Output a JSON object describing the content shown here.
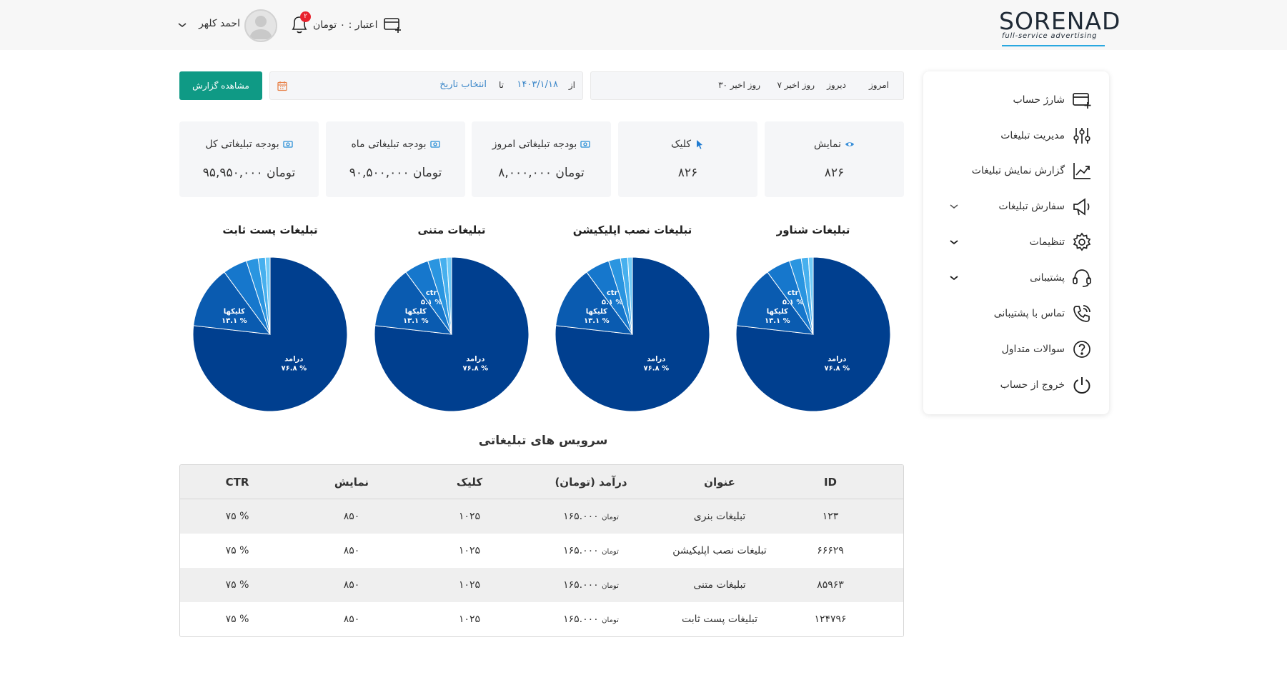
{
  "header": {
    "logo_main": "SOREN",
    "logo_ad": "AD",
    "logo_sub": "full-service advertising",
    "credit_label": "اعتبار : ۰ تومان",
    "notifications_count": "۲",
    "username": "احمد کلهر"
  },
  "sidebar": {
    "items": [
      {
        "label": "شارژ حساب",
        "icon": "add-card-icon"
      },
      {
        "label": "مدیریت تبلیغات",
        "icon": "sliders-icon"
      },
      {
        "label": "گزارش نمایش تبلیغات",
        "icon": "chart-line-icon"
      },
      {
        "label": "سفارش تبلیغات",
        "icon": "megaphone-icon"
      },
      {
        "label": "تنظیمات",
        "icon": "gear-icon"
      },
      {
        "label": "پشتیبانی",
        "icon": "headset-icon"
      },
      {
        "label": "تماس با پشتیبانی",
        "icon": "phone-icon"
      },
      {
        "label": "سوالات متداول",
        "icon": "question-icon"
      },
      {
        "label": "خروج از حساب",
        "icon": "power-icon"
      }
    ]
  },
  "filters": {
    "today": "امروز",
    "yesterday": "دیروز",
    "last7": "۷ روز اخیر",
    "last30": "۳۰ روز اخیر"
  },
  "date": {
    "from_label": "از",
    "from_value": "۱۴۰۳/۱/۱۸",
    "to_label": "تا",
    "to_value": "انتخاب تاریخ"
  },
  "report_button": "مشاهده گزارش",
  "stats": [
    {
      "label": "نمایش",
      "value": "۸۲۶",
      "icon": "eye-icon"
    },
    {
      "label": "کلیک",
      "value": "۸۲۶",
      "icon": "cursor-icon"
    },
    {
      "label": "بودجه تبلیغاتی امروز",
      "value": "۸,۰۰۰,۰۰۰ تومان",
      "icon": "cash-icon"
    },
    {
      "label": "بودجه تبلیغاتی ماه",
      "value": "۹۰,۵۰۰,۰۰۰ تومان",
      "icon": "cash-icon"
    },
    {
      "label": "بودجه تبلیغاتی کل",
      "value": "۹۵,۹۵۰,۰۰۰ تومان",
      "icon": "cash-icon"
    }
  ],
  "charts": {
    "titles": [
      "تبلیغات شناور",
      "تبلیغات نصب اپلیکیشن",
      "تبلیغات متنی",
      "تبلیغات پست ثابت"
    ],
    "slice_labels": {
      "revenue": "درامد",
      "revenue_pct": "۷۶.۸ %",
      "clicks": "کلیکها",
      "clicks_pct": "۱۳.۱ %",
      "ctr": "ctr",
      "ctr_pct": "۵.۱ %"
    },
    "colors": [
      "#003f8f",
      "#0a5bb0",
      "#1677cc",
      "#2a95e0",
      "#47b0ee",
      "#6fcaf7"
    ]
  },
  "chart_data": [
    {
      "type": "pie",
      "title": "تبلیغات شناور",
      "labels": [
        "درامد",
        "کلیکها",
        "ctr",
        "",
        "",
        ""
      ],
      "values": [
        76.8,
        13.1,
        5.1,
        2.5,
        1.5,
        1.0
      ]
    },
    {
      "type": "pie",
      "title": "تبلیغات نصب اپلیکیشن",
      "labels": [
        "درامد",
        "کلیکها",
        "ctr",
        "",
        "",
        ""
      ],
      "values": [
        76.8,
        13.1,
        5.1,
        2.5,
        1.5,
        1.0
      ]
    },
    {
      "type": "pie",
      "title": "تبلیغات متنی",
      "labels": [
        "درامد",
        "کلیکها",
        "ctr",
        "",
        "",
        ""
      ],
      "values": [
        76.8,
        13.1,
        5.1,
        2.5,
        1.5,
        1.0
      ]
    },
    {
      "type": "pie",
      "title": "تبلیغات پست ثابت",
      "labels": [
        "درامد",
        "کلیکها",
        "",
        "",
        "",
        ""
      ],
      "values": [
        76.8,
        13.1,
        5.1,
        2.5,
        1.5,
        1.0
      ]
    }
  ],
  "services": {
    "title": "سرویس های تبلیغاتی",
    "columns": [
      "ID",
      "عنوان",
      "درآمد (تومان)",
      "کلیک",
      "نمایش",
      "CTR"
    ],
    "rows": [
      {
        "id": "۱۲۳",
        "title": "تبلیغات بنری",
        "revenue": "۱۶۵.۰۰۰",
        "currency": "تومان",
        "clicks": "۱۰۲۵",
        "views": "۸۵۰",
        "ctr": "۷۵ %"
      },
      {
        "id": "۶۶۶۲۹",
        "title": "تبلیغات نصب اپلیکیشن",
        "revenue": "۱۶۵.۰۰۰",
        "currency": "تومان",
        "clicks": "۱۰۲۵",
        "views": "۸۵۰",
        "ctr": "۷۵ %"
      },
      {
        "id": "۸۵۹۶۳",
        "title": "تبلیغات متنی",
        "revenue": "۱۶۵.۰۰۰",
        "currency": "تومان",
        "clicks": "۱۰۲۵",
        "views": "۸۵۰",
        "ctr": "۷۵ %"
      },
      {
        "id": "۱۲۴۷۹۶",
        "title": "تبلیغات پست ثابت",
        "revenue": "۱۶۵.۰۰۰",
        "currency": "تومان",
        "clicks": "۱۰۲۵",
        "views": "۸۵۰",
        "ctr": "۷۵ %"
      }
    ]
  }
}
